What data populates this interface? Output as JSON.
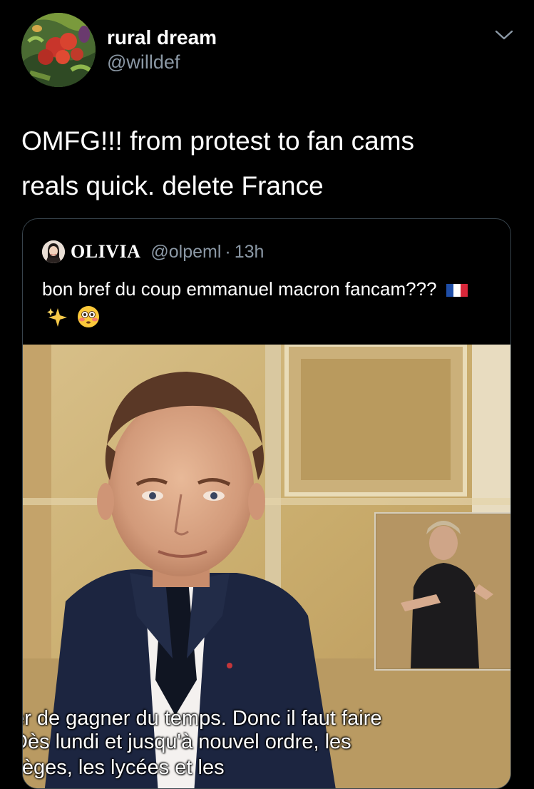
{
  "tweet": {
    "display_name": "rural dream",
    "handle": "@willdef",
    "text": "OMFG!!! from protest to fan cams\nreals quick. delete France",
    "menu_icon": "chevron-down-icon",
    "avatar_icon": "vegetables-avatar"
  },
  "quoted_tweet": {
    "display_name": "OLIVIA",
    "handle": "@olpeml",
    "separator": "·",
    "time": "13h",
    "text": "bon bref du coup emmanuel macron fancam???",
    "emojis": [
      "flag-france",
      "sparkles",
      "flushed-face"
    ],
    "avatar_icon": "person-avatar"
  },
  "video": {
    "captions": [
      "er de gagner du temps. Donc il faut faire",
      "Dès lundi et jusqu'à nouvel ordre, les",
      "llèges, les lycées et les"
    ]
  },
  "colors": {
    "background": "#000000",
    "secondary_text": "#8b98a5",
    "card_border": "#38444d"
  }
}
